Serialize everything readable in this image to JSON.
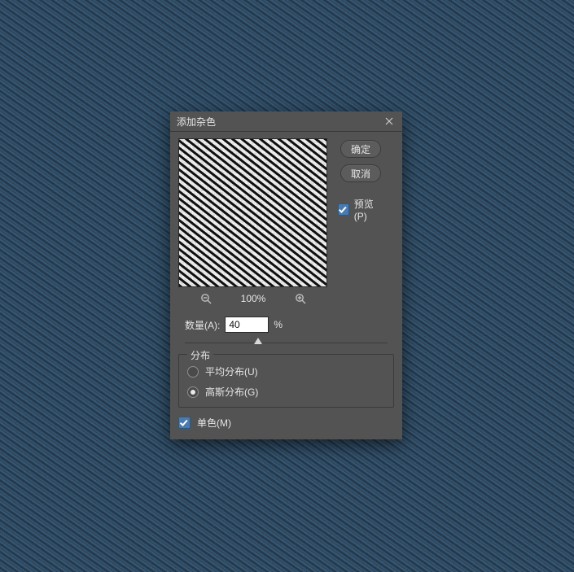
{
  "dialog": {
    "title": "添加杂色",
    "ok_label": "确定",
    "cancel_label": "取消",
    "preview_label": "预览(P)",
    "preview_checked": true,
    "zoom_level": "100%",
    "amount": {
      "label": "数量(A):",
      "value": "40",
      "unit": "%",
      "slider_pct": 34
    },
    "distribution": {
      "legend": "分布",
      "uniform_label": "平均分布(U)",
      "gaussian_label": "高斯分布(G)",
      "selected": "gaussian"
    },
    "monochrome": {
      "label": "单色(M)",
      "checked": true
    }
  },
  "icons": {
    "close": "close-icon",
    "zoom_out": "zoom-out-icon",
    "zoom_in": "zoom-in-icon"
  }
}
